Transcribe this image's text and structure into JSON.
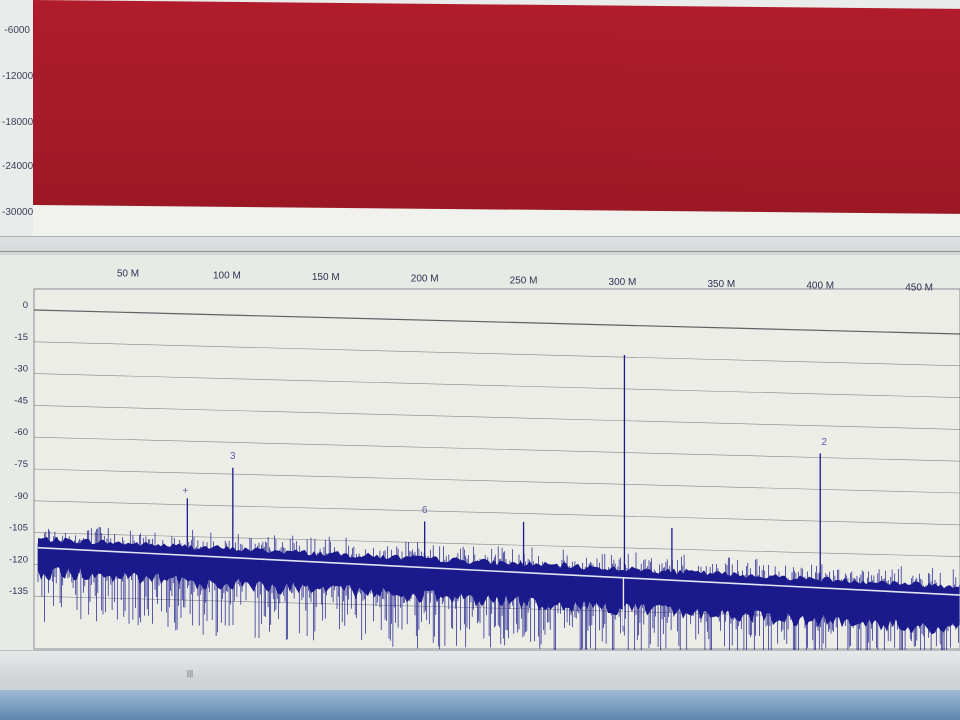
{
  "time_panel": {
    "y_ticks": [
      "-6000",
      "-12000",
      "-18000",
      "-24000",
      "-30000"
    ]
  },
  "spectrum": {
    "x_ticks": [
      "50 M",
      "100 M",
      "150 M",
      "200 M",
      "250 M",
      "300 M",
      "350 M",
      "400 M",
      "450 M"
    ],
    "y_ticks": [
      "0",
      "-15",
      "-30",
      "-45",
      "-60",
      "-75",
      "-90",
      "-105",
      "-120",
      "-135"
    ],
    "markers": [
      "+",
      "3",
      "6",
      "2"
    ]
  },
  "colors": {
    "time_fill": "#a51a29",
    "spectrum_trace": "#1a1a8c",
    "noise_floor_line": "#dfe4ef",
    "plot_bg": "#ecede6",
    "grid": "#6a6f75"
  },
  "chart_data": {
    "type": "line",
    "title": "",
    "xlabel": "",
    "ylabel": "",
    "x_unit": "MHz",
    "xlim": [
      10,
      465
    ],
    "ylim": [
      -150,
      0
    ],
    "grid": true,
    "noise_floor": {
      "x": [
        0,
        465
      ],
      "y": [
        -112,
        -123
      ]
    },
    "peaks": [
      {
        "x": 80,
        "y": -87
      },
      {
        "x": 103,
        "y": -72
      },
      {
        "x": 200,
        "y": -95
      },
      {
        "x": 250,
        "y": -94
      },
      {
        "x": 301,
        "y": -14
      },
      {
        "x": 325,
        "y": -95
      },
      {
        "x": 400,
        "y": -58
      }
    ]
  }
}
